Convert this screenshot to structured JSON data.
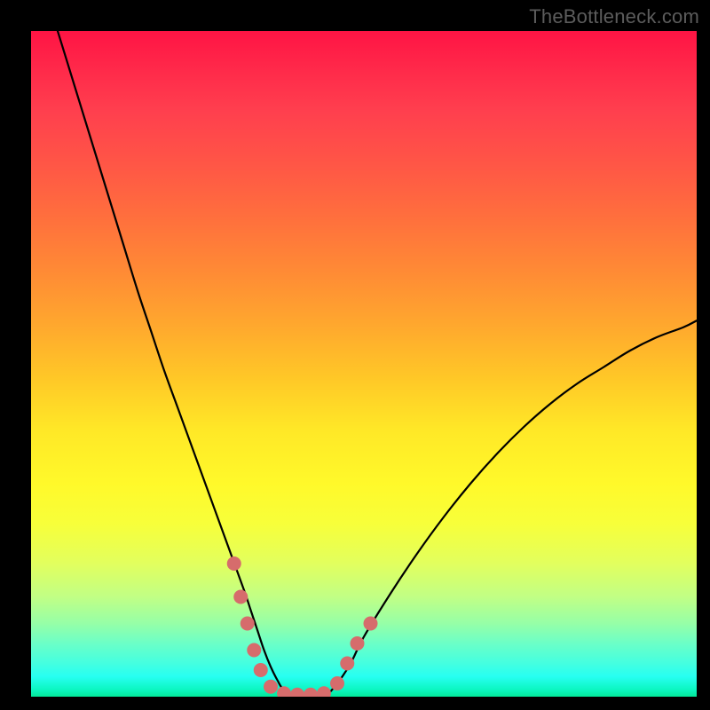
{
  "watermark": {
    "text": "TheBottleneck.com"
  },
  "colors": {
    "curve": "#000000",
    "marker_fill": "#d66c6c",
    "marker_stroke": "#c94f4f",
    "background_black": "#000000"
  },
  "chart_data": {
    "type": "line",
    "title": "",
    "xlabel": "",
    "ylabel": "",
    "xlim": [
      0,
      100
    ],
    "ylim": [
      0,
      100
    ],
    "grid": false,
    "legend": false,
    "series": [
      {
        "name": "curve",
        "x": [
          4,
          6,
          8,
          10,
          12,
          14,
          16,
          18,
          20,
          22,
          24,
          26,
          28,
          30,
          32,
          33,
          34,
          35,
          36,
          37,
          38,
          40,
          42,
          44,
          46,
          48,
          50,
          54,
          58,
          62,
          66,
          70,
          74,
          78,
          82,
          86,
          90,
          94,
          98,
          100
        ],
        "y": [
          100,
          93.5,
          87,
          80.5,
          74,
          67.5,
          61,
          55,
          49,
          43.5,
          38,
          32.5,
          27,
          21.5,
          16,
          13,
          10,
          7,
          4.5,
          2.5,
          1,
          0,
          0,
          0,
          2,
          5,
          9,
          15.5,
          21.5,
          27,
          32,
          36.5,
          40.5,
          44,
          47,
          49.5,
          52,
          54,
          55.5,
          56.5
        ]
      }
    ],
    "markers": [
      {
        "x": 30.5,
        "y": 20
      },
      {
        "x": 31.5,
        "y": 15
      },
      {
        "x": 32.5,
        "y": 11
      },
      {
        "x": 33.5,
        "y": 7
      },
      {
        "x": 34.5,
        "y": 4
      },
      {
        "x": 36,
        "y": 1.5
      },
      {
        "x": 38,
        "y": 0.5
      },
      {
        "x": 40,
        "y": 0.3
      },
      {
        "x": 42,
        "y": 0.3
      },
      {
        "x": 44,
        "y": 0.5
      },
      {
        "x": 46,
        "y": 2
      },
      {
        "x": 47.5,
        "y": 5
      },
      {
        "x": 49,
        "y": 8
      },
      {
        "x": 51,
        "y": 11
      }
    ]
  }
}
